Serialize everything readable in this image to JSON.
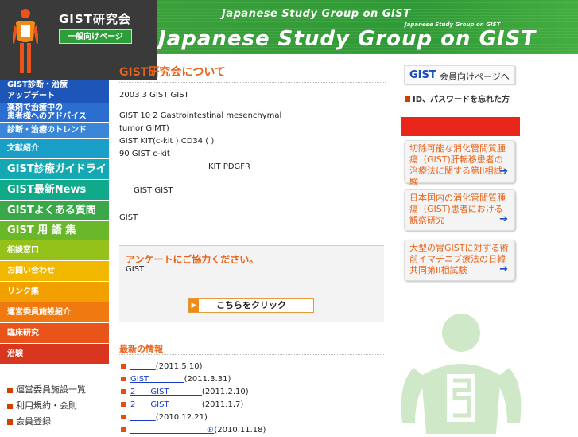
{
  "header": {
    "site_title": "GIST研究会",
    "public_page_label": "一般向けページ",
    "banner_line1": "Japanese  Study Group on GIST",
    "banner_line2": "Japanese Study Group on GIST",
    "banner_line3": "Japanese  Study Group on GIST"
  },
  "sidebar": {
    "items": [
      {
        "label": "GIST診断・治療\nアップデート",
        "color": "#1d56b8"
      },
      {
        "label": "薬剤で治療中の\n患者様へのアドバイス",
        "color": "#2a6fd0"
      },
      {
        "label": "診断・治療のトレンド",
        "color": "#3a86d8"
      },
      {
        "label": "文献紹介",
        "color": "#1aa0c8"
      },
      {
        "label": "GIST診療ガイドライン",
        "color": "#14a9b2"
      },
      {
        "label": "GIST最新News",
        "color": "#10aa8a"
      },
      {
        "label": "GISTよくある質問",
        "color": "#3aa848"
      },
      {
        "label": "GIST 用 語 集",
        "color": "#6ab82a"
      },
      {
        "label": "相談窓口",
        "color": "#94c21a"
      },
      {
        "label": "お問い合わせ",
        "color": "#f2b800"
      },
      {
        "label": "リンク集",
        "color": "#f2a000"
      },
      {
        "label": "運営委員施設紹介",
        "color": "#f07a10"
      },
      {
        "label": "臨床研究",
        "color": "#e8541a"
      },
      {
        "label": "治験",
        "color": "#d8361e"
      }
    ],
    "sub_links": [
      "運営委員施設一覧",
      "利用規約・会則",
      "会員登録"
    ]
  },
  "main": {
    "heading": "GIST研究会について",
    "para1": "2003 3  GIST                                GIST",
    "para2_l1": "GIST       10  2                                    Gastrointestinal mesenchymal",
    "para2_l2": "tumor GIMT)",
    "para2_l3": "GIST KIT(c-kit    ) CD34         ( )",
    "para2_l4": "   90  GIST  c-kit",
    "para2_l5": "KIT PDGFR",
    "para3": "GIST                       GIST",
    "para4": "GIST",
    "survey_title": "アンケートにご協力ください。",
    "survey_body": "GIST",
    "click_label": "こちらをクリック",
    "news_heading": "最新の情報",
    "news": [
      {
        "link": "          ",
        "date": "(2011.5.10)"
      },
      {
        "link": "GIST              ",
        "date": "(2011.3.31)"
      },
      {
        "link": "2      GIST             ",
        "date": "(2011.2.10)"
      },
      {
        "link": "2      GIST             ",
        "date": "(2011.1.7)"
      },
      {
        "link": "          ",
        "date": "(2010.12.21)"
      },
      {
        "link": "                              ®",
        "date": "(2010.11.18)"
      }
    ]
  },
  "right": {
    "member_logo": "GIST",
    "member_label": "会員向けページへ",
    "forgot_label": "ID、パスワードを忘れた方",
    "cards": [
      {
        "text": "切除可能な消化管間質腫瘍（GIST)肝転移患者の治療法に関する第II相試験"
      },
      {
        "text": "日本国内の消化管間質腫瘍（GIST)患者における観察研究"
      },
      {
        "text": "大型の胃GISTに対する術前イマチニブ療法の日韓共同第II相試験"
      }
    ]
  }
}
